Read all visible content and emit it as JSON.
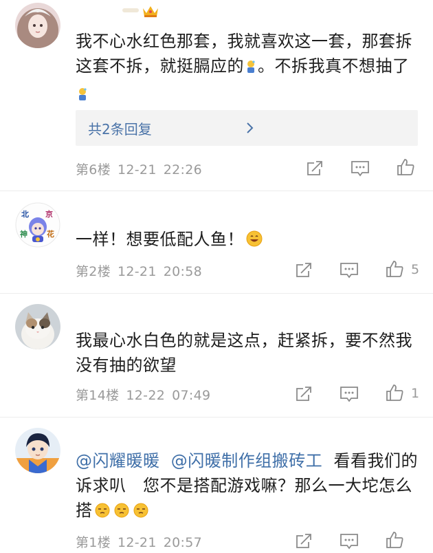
{
  "comments": [
    {
      "text_parts": [
        "我不心水红色那套，我就喜欢这一套，那套拆这套不拆，就挺膈应的",
        "。不拆我真不想抽了"
      ],
      "reply_label": "共2条回复",
      "floor": "第6楼",
      "date": "12-21",
      "time": "22:26",
      "likes": ""
    },
    {
      "text": "一样！想要低配人鱼！",
      "avatar_text": [
        "北",
        "京",
        "神",
        "花"
      ],
      "floor": "第2楼",
      "date": "12-21",
      "time": "20:58",
      "likes": "5"
    },
    {
      "text": "我最心水白色的就是这点，赶紧拆，要不然我没有抽的欲望",
      "floor": "第14楼",
      "date": "12-22",
      "time": "07:49",
      "likes": "1"
    },
    {
      "mention1": "@闪耀暖暖",
      "mention2": "@闪暖制作组搬砖工",
      "text": "看看我们的诉求叭　您不是搭配游戏嘛？那么一大坨怎么搭",
      "floor": "第1楼",
      "date": "12-21",
      "time": "20:57",
      "likes": ""
    }
  ],
  "icons": {
    "edit": "edit-icon",
    "comment": "comment-icon",
    "like": "like-icon",
    "crown": "crown-badge-icon",
    "chevron": "chevron-right-icon"
  },
  "colors": {
    "mention": "#3f6fa8",
    "meta": "#9a9a9a",
    "reply_bg": "#f3f3f3",
    "reply_text": "#4a73a8",
    "crown": "#f2b01e"
  }
}
